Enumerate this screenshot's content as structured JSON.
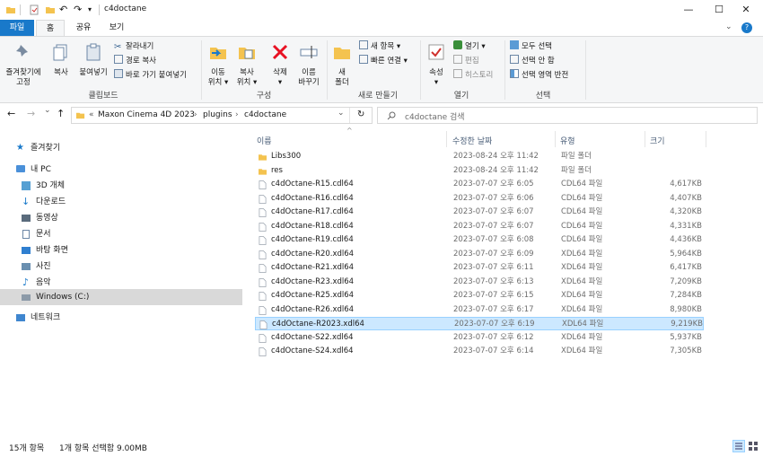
{
  "window": {
    "title": "c4doctane",
    "minimize": "—",
    "maximize": "☐",
    "close": "✕"
  },
  "tabs": [
    {
      "label": "파일"
    },
    {
      "label": "홈"
    },
    {
      "label": "공유"
    },
    {
      "label": "보기"
    }
  ],
  "ribbon": {
    "clipboard": {
      "label": "클립보드",
      "pin_l1": "즐겨찾기에",
      "pin_l2": "고정",
      "copy": "복사",
      "paste": "붙여넣기",
      "cut": "잘라내기",
      "copy_path": "경로 복사",
      "paste_shortcut": "바로 가기 붙여넣기"
    },
    "organize": {
      "label": "구성",
      "move_l1": "이동",
      "move_l2": "위치 ▾",
      "copyto_l1": "복사",
      "copyto_l2": "위치 ▾",
      "delete_l1": "삭제",
      "delete_l2": "▾",
      "rename_l1": "이름",
      "rename_l2": "바꾸기"
    },
    "new": {
      "label": "새로 만들기",
      "folder_l1": "새",
      "folder_l2": "폴더",
      "new_item": "새 항목 ▾",
      "easy_access": "빠른 연결 ▾"
    },
    "open": {
      "label": "열기",
      "properties_l1": "속성",
      "properties_l2": "▾",
      "open": "열기 ▾",
      "edit": "편집",
      "history": "히스토리"
    },
    "select": {
      "label": "선택",
      "all": "모두 선택",
      "none": "선택 안 함",
      "invert": "선택 영역 반전"
    }
  },
  "address": {
    "back": "←",
    "forward": "→",
    "recent": "⌄",
    "up": "↑",
    "overflow": "«",
    "crumbs": [
      "Maxon Cinema 4D 2023",
      "plugins",
      "c4doctane"
    ],
    "crumb_sep": "›",
    "dropdown": "⌄",
    "refresh": "↻",
    "search_placeholder": "c4doctane 검색"
  },
  "nav": {
    "quick_access": "즐겨찾기",
    "this_pc": "내 PC",
    "items": [
      {
        "label": "3D 개체"
      },
      {
        "label": "다운로드"
      },
      {
        "label": "동영상"
      },
      {
        "label": "문서"
      },
      {
        "label": "바탕 화면"
      },
      {
        "label": "사진"
      },
      {
        "label": "음악"
      },
      {
        "label": "Windows (C:)"
      }
    ],
    "network": "네트워크"
  },
  "list": {
    "sort_indicator": "^",
    "headers": {
      "name": "이름",
      "date": "수정한 날짜",
      "type": "유형",
      "size": "크기"
    },
    "rows": [
      {
        "name": "Libs300",
        "date": "2023-08-24 오후 11:42",
        "type": "파일 폴더",
        "size": "",
        "kind": "folder"
      },
      {
        "name": "res",
        "date": "2023-08-24 오후 11:42",
        "type": "파일 폴더",
        "size": "",
        "kind": "folder"
      },
      {
        "name": "c4dOctane-R15.cdl64",
        "date": "2023-07-07 오후 6:05",
        "type": "CDL64 파일",
        "size": "4,617KB",
        "kind": "file"
      },
      {
        "name": "c4dOctane-R16.cdl64",
        "date": "2023-07-07 오후 6:06",
        "type": "CDL64 파일",
        "size": "4,407KB",
        "kind": "file"
      },
      {
        "name": "c4dOctane-R17.cdl64",
        "date": "2023-07-07 오후 6:07",
        "type": "CDL64 파일",
        "size": "4,320KB",
        "kind": "file"
      },
      {
        "name": "c4dOctane-R18.cdl64",
        "date": "2023-07-07 오후 6:07",
        "type": "CDL64 파일",
        "size": "4,331KB",
        "kind": "file"
      },
      {
        "name": "c4dOctane-R19.cdl64",
        "date": "2023-07-07 오후 6:08",
        "type": "CDL64 파일",
        "size": "4,436KB",
        "kind": "file"
      },
      {
        "name": "c4dOctane-R20.xdl64",
        "date": "2023-07-07 오후 6:09",
        "type": "XDL64 파일",
        "size": "5,964KB",
        "kind": "file"
      },
      {
        "name": "c4dOctane-R21.xdl64",
        "date": "2023-07-07 오후 6:11",
        "type": "XDL64 파일",
        "size": "6,417KB",
        "kind": "file"
      },
      {
        "name": "c4dOctane-R23.xdl64",
        "date": "2023-07-07 오후 6:13",
        "type": "XDL64 파일",
        "size": "7,209KB",
        "kind": "file"
      },
      {
        "name": "c4dOctane-R25.xdl64",
        "date": "2023-07-07 오후 6:15",
        "type": "XDL64 파일",
        "size": "7,284KB",
        "kind": "file"
      },
      {
        "name": "c4dOctane-R26.xdl64",
        "date": "2023-07-07 오후 6:17",
        "type": "XDL64 파일",
        "size": "8,980KB",
        "kind": "file"
      },
      {
        "name": "c4dOctane-R2023.xdl64",
        "date": "2023-07-07 오후 6:19",
        "type": "XDL64 파일",
        "size": "9,219KB",
        "kind": "file",
        "selected": true
      },
      {
        "name": "c4dOctane-S22.xdl64",
        "date": "2023-07-07 오후 6:12",
        "type": "XDL64 파일",
        "size": "5,937KB",
        "kind": "file"
      },
      {
        "name": "c4dOctane-S24.xdl64",
        "date": "2023-07-07 오후 6:14",
        "type": "XDL64 파일",
        "size": "7,305KB",
        "kind": "file"
      }
    ]
  },
  "status": {
    "count": "15개 항목",
    "selection": "1개 항목 선택함 9.00MB"
  },
  "colors": {
    "accent": "#1979ca",
    "folder": "#f4c34f",
    "selected_bg": "#cce8ff",
    "selected_border": "#99d1ff",
    "delete_red": "#e81123"
  }
}
